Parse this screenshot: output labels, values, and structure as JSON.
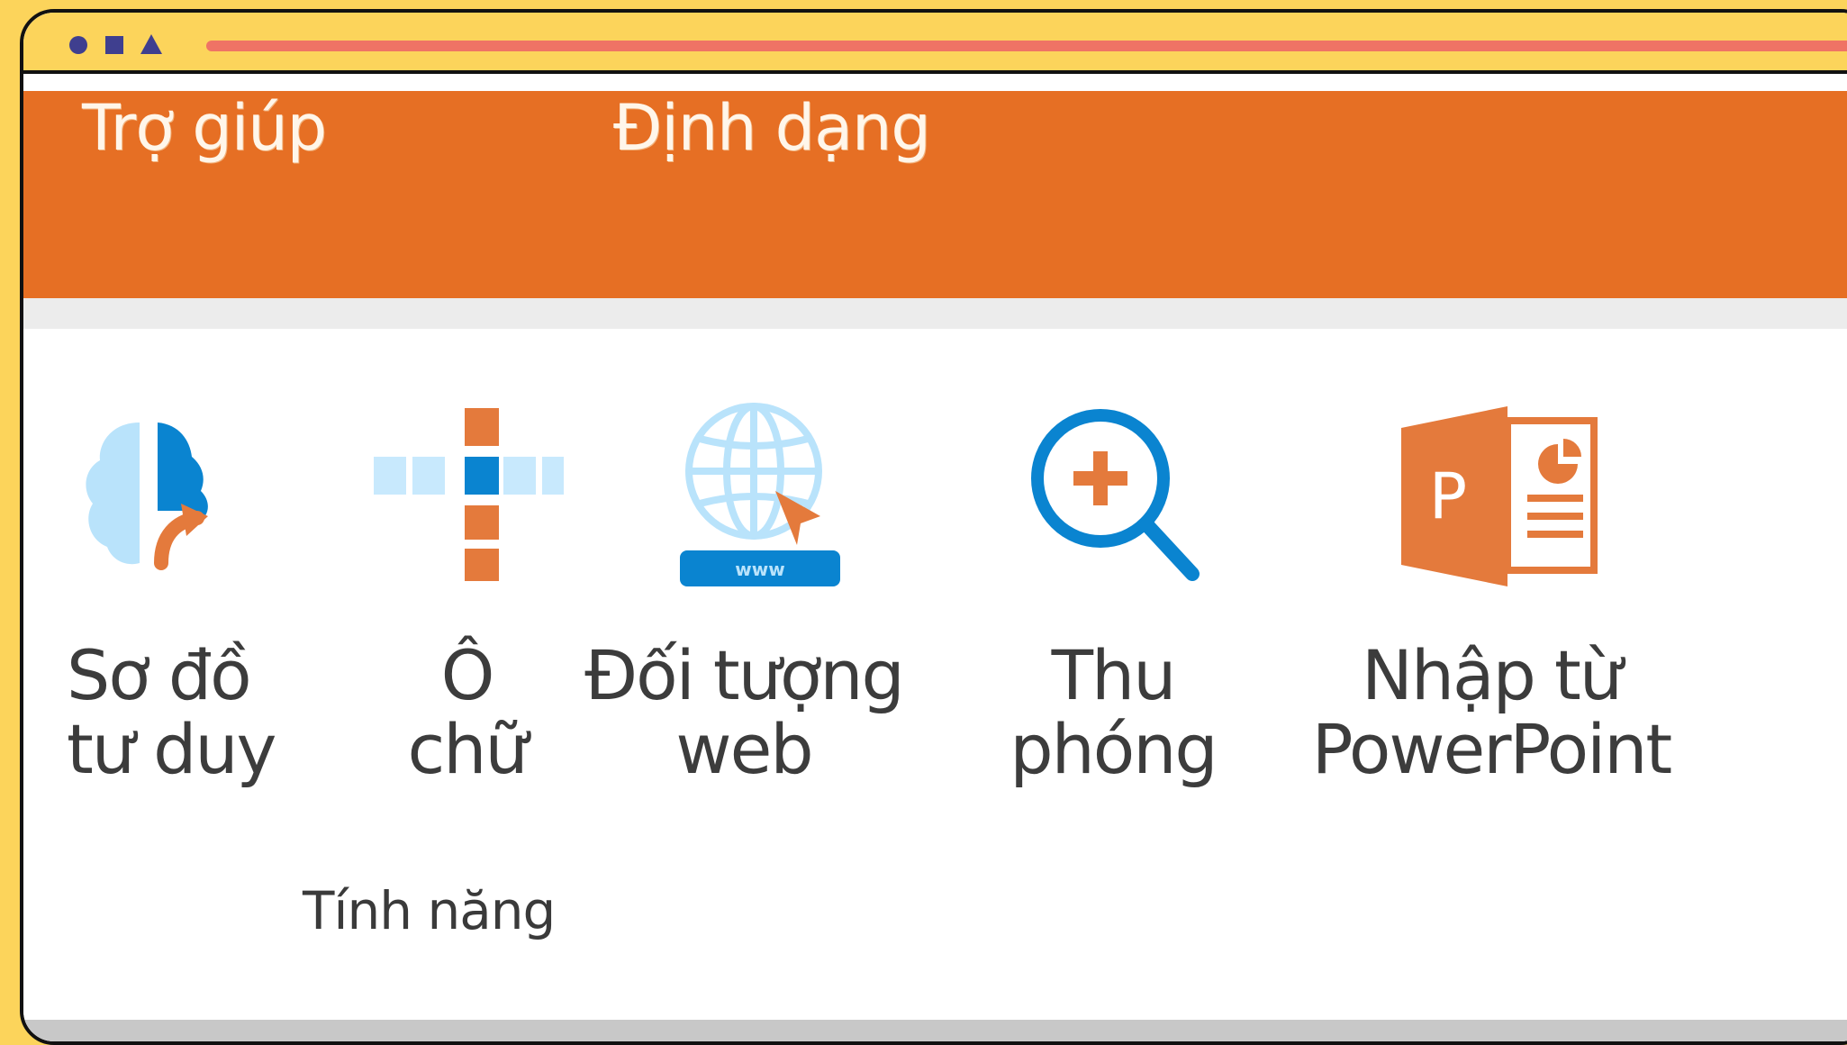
{
  "window_controls": {
    "close": "circle-control-icon",
    "minimize": "square-control-icon",
    "maximize": "triangle-control-icon"
  },
  "tabs": [
    {
      "label": "Trợ giúp"
    },
    {
      "label": "Định dạng"
    }
  ],
  "tools": [
    {
      "label": "Sơ đồ\ntư duy",
      "icon": "mind-map-icon"
    },
    {
      "label": "Ô\nchữ",
      "icon": "crossword-icon"
    },
    {
      "label": "Đối tượng\nweb",
      "icon": "web-object-icon"
    },
    {
      "label": "Thu\nphóng",
      "icon": "zoom-icon"
    },
    {
      "label": "Nhập từ\nPowerPoint",
      "icon": "powerpoint-icon"
    }
  ],
  "group_label": "Tính năng",
  "colors": {
    "background": "#fcd45b",
    "ribbon": "#e66f24",
    "accent_blue": "#0a84d0",
    "light_blue": "#b9e3fb",
    "orange": "#e47a3c",
    "control": "#3f3f8f",
    "address_line": "#ef7365"
  }
}
